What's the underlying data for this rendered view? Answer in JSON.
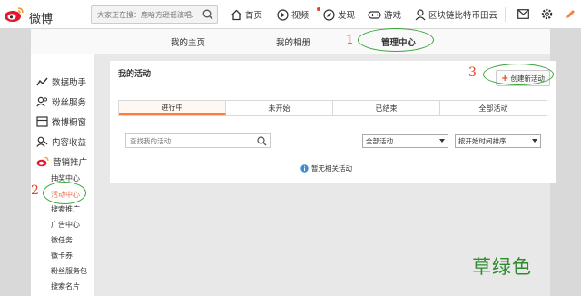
{
  "app": {
    "logo_text": "微博"
  },
  "search": {
    "placeholder": "大家正在搜：鹿晗方逊谣演唱..."
  },
  "nav": [
    {
      "label": "首页",
      "icon": "home-icon"
    },
    {
      "label": "视频",
      "icon": "video-icon"
    },
    {
      "label": "发现",
      "icon": "discover-icon"
    },
    {
      "label": "游戏",
      "icon": "game-icon"
    },
    {
      "label": "区块链比特币田云",
      "icon": "user-icon"
    }
  ],
  "top_tabs": [
    {
      "label": "我的主页"
    },
    {
      "label": "我的相册"
    },
    {
      "label": "管理中心",
      "active": true
    }
  ],
  "sidebar": {
    "items": [
      {
        "label": "数据助手",
        "icon": "data-icon"
      },
      {
        "label": "粉丝服务",
        "icon": "fans-icon"
      },
      {
        "label": "微博橱窗",
        "icon": "shop-icon"
      },
      {
        "label": "内容收益",
        "icon": "income-icon"
      },
      {
        "label": "营销推广",
        "icon": "weibo-logo-icon"
      }
    ],
    "sub_items": [
      {
        "label": "抽奖中心"
      },
      {
        "label": "活动中心",
        "active": true
      },
      {
        "label": "搜索推广"
      },
      {
        "label": "广告中心"
      },
      {
        "label": "微任务"
      },
      {
        "label": "微卡券"
      },
      {
        "label": "粉丝服务包"
      },
      {
        "label": "搜索名片"
      }
    ]
  },
  "main": {
    "title": "我的活动",
    "create_button": "创建新活动",
    "status_tabs": [
      "进行中",
      "未开始",
      "已结束",
      "全部活动"
    ],
    "search_placeholder": "查找我的活动",
    "filter_select": "全部活动",
    "sort_select": "按开始时间排序",
    "empty_text": "暂无相关活动"
  },
  "annotations": {
    "num1": "1",
    "num2": "2",
    "num3": "3",
    "caption": "草绿色"
  },
  "colors": {
    "accent": "#fa7d3c",
    "annotation_red": "#e8431f",
    "annotation_green": "#3aa53a"
  }
}
